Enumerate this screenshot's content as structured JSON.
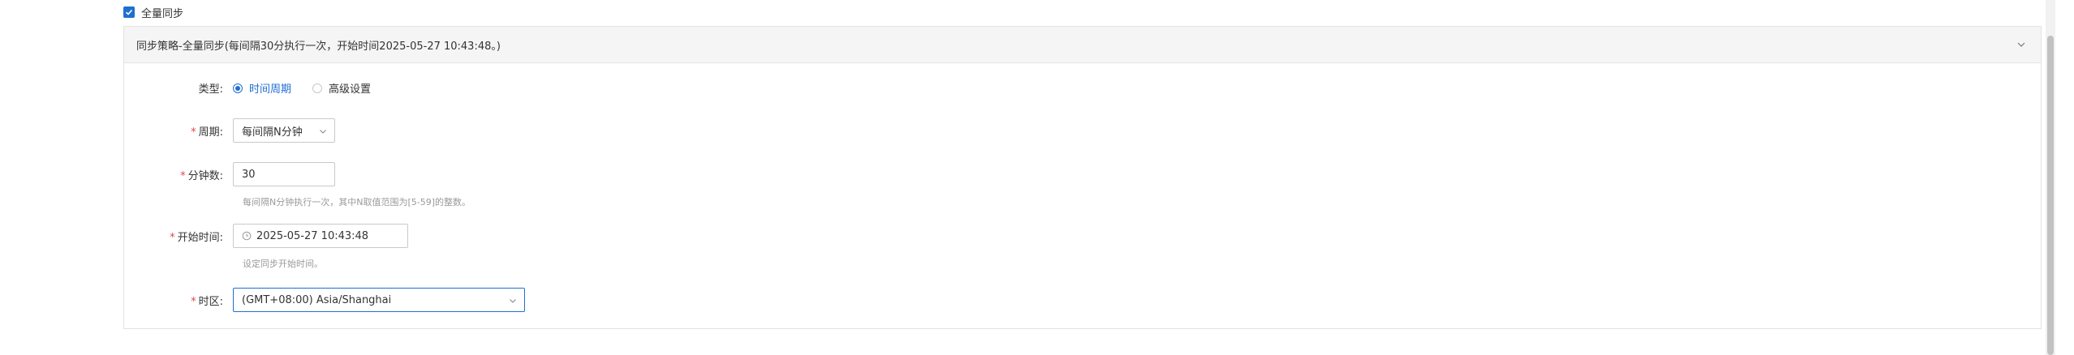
{
  "full_sync": {
    "label": "全量同步",
    "checked": true
  },
  "panel": {
    "title": "同步策略-全量同步(每间隔30分执行一次，开始时间2025-05-27 10:43:48。)"
  },
  "form": {
    "type": {
      "label": "类型:",
      "options": [
        "时间周期",
        "高级设置"
      ],
      "selected": "时间周期"
    },
    "period": {
      "label": "周期:",
      "value": "每间隔N分钟"
    },
    "minutes": {
      "label": "分钟数:",
      "value": "30",
      "hint": "每间隔N分钟执行一次，其中N取值范围为[5-59]的整数。"
    },
    "start_time": {
      "label": "开始时间:",
      "value": "2025-05-27 10:43:48",
      "hint": "设定同步开始时间。"
    },
    "timezone": {
      "label": "时区:",
      "value": "(GMT+08:00) Asia/Shanghai"
    }
  },
  "colors": {
    "accent": "#1f6fd1",
    "required": "#e04848"
  }
}
